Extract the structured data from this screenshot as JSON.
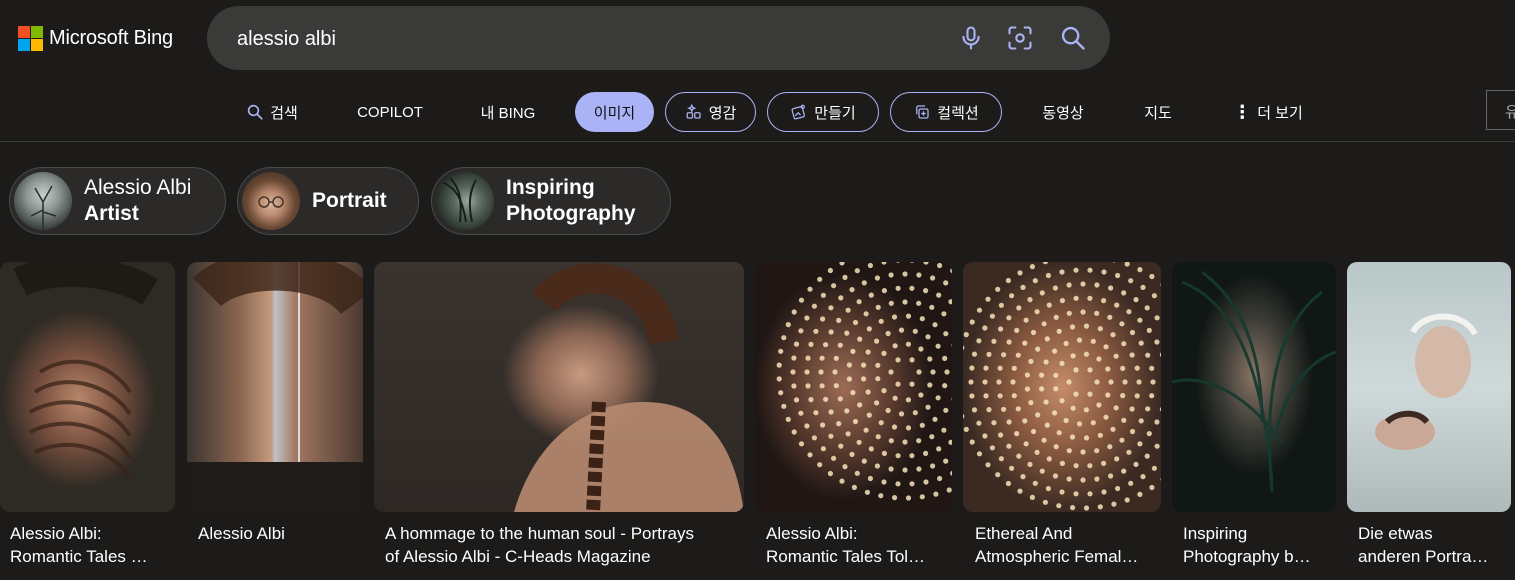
{
  "header": {
    "logo_text": "Microsoft Bing",
    "search_value": "alessio albi"
  },
  "nav": {
    "search": "검색",
    "copilot": "COPILOT",
    "my_bing": "내 BING",
    "images": "이미지",
    "inspiration": "영감",
    "create": "만들기",
    "collections": "컬렉션",
    "videos": "동영상",
    "maps": "지도",
    "more": "더 보기",
    "right_stub": "유"
  },
  "chips": [
    {
      "line1": "Alessio Albi",
      "line2": "Artist"
    },
    {
      "line1": "Portrait"
    },
    {
      "line1": "Inspiring",
      "line2": "Photography"
    }
  ],
  "results": [
    {
      "line1": "Alessio Albi:",
      "line2": "Romantic Tales …"
    },
    {
      "line1": "Alessio Albi",
      "line2": ""
    },
    {
      "line1": "A hommage to the human soul - Portrays",
      "line2": "of Alessio Albi - C-Heads Magazine"
    },
    {
      "line1": "Alessio Albi:",
      "line2": "Romantic Tales Tol…"
    },
    {
      "line1": "Ethereal And",
      "line2": "Atmospheric Femal…"
    },
    {
      "line1": "Inspiring",
      "line2": "Photography b…"
    },
    {
      "line1": "Die etwas",
      "line2": "anderen Portra…"
    }
  ],
  "colors": {
    "background": "#1c1b1a",
    "accent": "#aab3f5",
    "search_box": "#3a3a39"
  }
}
